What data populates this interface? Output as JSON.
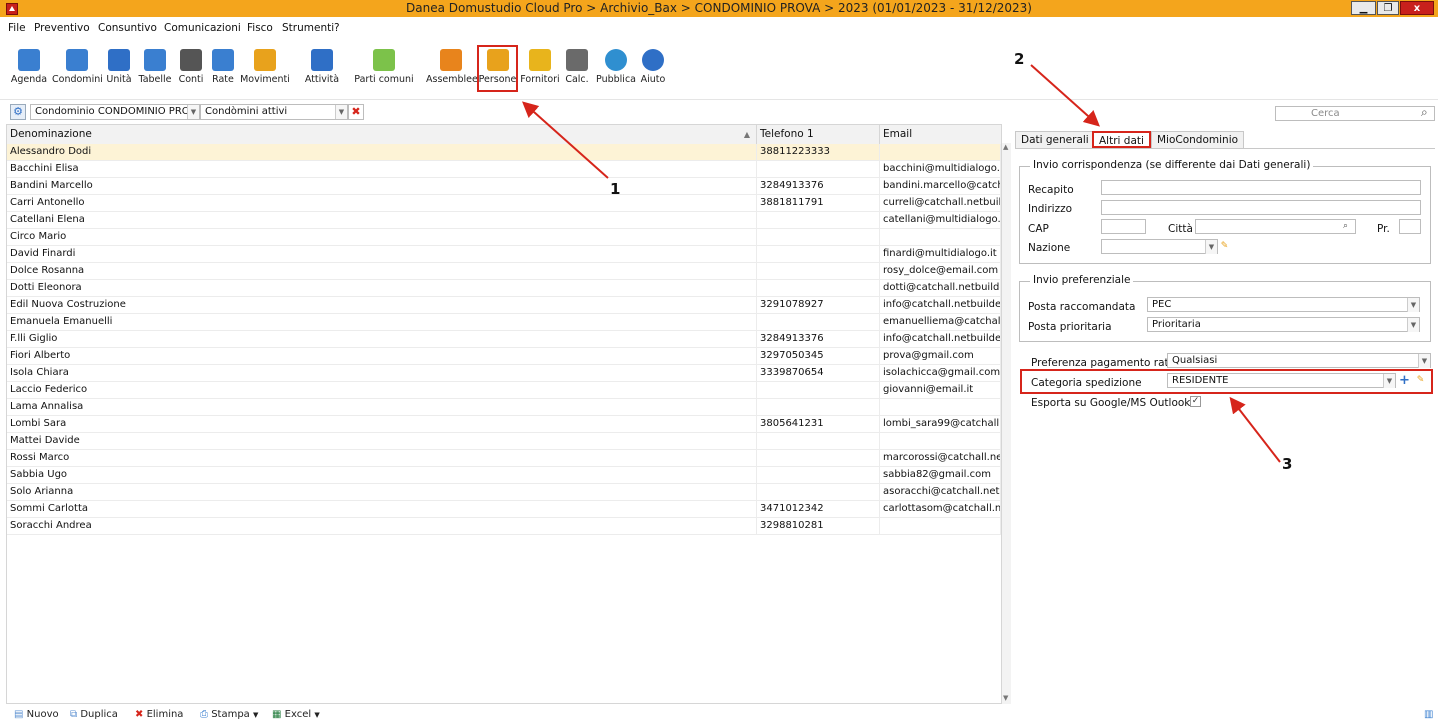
{
  "window": {
    "title": "Danea Domustudio Cloud Pro > Archivio_Bax > CONDOMINIO PROVA  > 2023    (01/01/2023 - 31/12/2023)",
    "min_glyph": "▁",
    "max_glyph": "❐",
    "close_glyph": "x"
  },
  "menu": [
    "File",
    "Preventivo",
    "Consuntivo",
    "Comunicazioni",
    "Fisco",
    "Strumenti",
    "?"
  ],
  "toolbar": [
    {
      "label": "Agenda",
      "icon": "house-icon",
      "color": "#3a7fd0"
    },
    {
      "label": "Condomini",
      "icon": "building-icon",
      "color": "#3a7fd0"
    },
    {
      "label": "Unità",
      "icon": "cubes-icon",
      "color": "#2f6fc6"
    },
    {
      "label": "Tabelle",
      "icon": "table-icon",
      "color": "#3a7fd0"
    },
    {
      "label": "Conti",
      "icon": "abacus-icon",
      "color": "#555555"
    },
    {
      "label": "Rate",
      "icon": "share-icon",
      "color": "#3a7fd0"
    },
    {
      "label": "Movimenti",
      "icon": "bar-chart-icon",
      "color": "#e8a21c"
    },
    {
      "label": "Attività",
      "icon": "drill-icon",
      "color": "#2f6fc6"
    },
    {
      "label": "Parti comuni",
      "icon": "puzzle-icon",
      "color": "#7cc24a"
    },
    {
      "label": "Assemblee",
      "icon": "people-icon",
      "color": "#e8841c"
    },
    {
      "label": "Persone",
      "icon": "persons-icon",
      "color": "#e8a21c"
    },
    {
      "label": "Fornitori",
      "icon": "supplier-icon",
      "color": "#e8b41c"
    },
    {
      "label": "Calc.",
      "icon": "calculator-icon",
      "color": "#6a6a6a"
    },
    {
      "label": "Pubblica",
      "icon": "globe-icon",
      "color": "#2f8fd0"
    },
    {
      "label": "Aiuto",
      "icon": "help-icon",
      "color": "#2f6fc6"
    }
  ],
  "filters": {
    "condominio": "Condominio CONDOMINIO PROVA",
    "stato": "Condòmini attivi",
    "search_placeholder": "Cerca"
  },
  "grid": {
    "columns": [
      "Denominazione",
      "Telefono 1",
      "Email"
    ],
    "rows": [
      [
        "Alessandro Dodi",
        "38811223333",
        ""
      ],
      [
        "Bacchini Elisa",
        "",
        "bacchini@multidialogo.it"
      ],
      [
        "Bandini Marcello",
        "3284913376",
        "bandini.marcello@catch..."
      ],
      [
        "Carri Antonello",
        "3881811791",
        "curreli@catchall.netbuild..."
      ],
      [
        "Catellani Elena",
        "",
        "catellani@multidialogo.it"
      ],
      [
        "Circo Mario",
        "",
        ""
      ],
      [
        "David Finardi",
        "",
        "finardi@multidialogo.it"
      ],
      [
        "Dolce Rosanna",
        "",
        "rosy_dolce@email.com"
      ],
      [
        "Dotti Eleonora",
        "",
        "dotti@catchall.netbuilde..."
      ],
      [
        "Edil Nuova Costruzione",
        "3291078927",
        "info@catchall.netbuilder.it"
      ],
      [
        "Emanuela Emanuelli",
        "",
        "emanuelliema@catchall...."
      ],
      [
        "F.lli Giglio",
        "3284913376",
        "info@catchall.netbuilder.it"
      ],
      [
        "Fiori Alberto",
        "3297050345",
        "prova@gmail.com"
      ],
      [
        "Isola Chiara",
        "3339870654",
        "isolachicca@gmail.com"
      ],
      [
        "Laccio Federico",
        "",
        "giovanni@email.it"
      ],
      [
        "Lama Annalisa",
        "",
        ""
      ],
      [
        "Lombi Sara",
        "3805641231",
        "lombi_sara99@catchall...."
      ],
      [
        "Mattei Davide",
        "",
        ""
      ],
      [
        "Rossi Marco",
        "",
        "marcorossi@catchall.net..."
      ],
      [
        "Sabbia Ugo",
        "",
        "sabbia82@gmail.com"
      ],
      [
        "Solo Arianna",
        "",
        "asoracchi@catchall.netb..."
      ],
      [
        "Sommi Carlotta",
        "3471012342",
        "carlottasom@catchall.ne..."
      ],
      [
        "Soracchi Andrea",
        "3298810281",
        ""
      ]
    ]
  },
  "tabs": [
    "Dati generali",
    "Altri dati",
    "MioCondominio"
  ],
  "corrispondenza": {
    "title": "Invio corrispondenza (se differente dai Dati generali)",
    "recapito_label": "Recapito",
    "indirizzo_label": "Indirizzo",
    "cap_label": "CAP",
    "citta_label": "Città",
    "pr_label": "Pr.",
    "nazione_label": "Nazione"
  },
  "preferenziale": {
    "title": "Invio preferenziale",
    "raccomandata_label": "Posta raccomandata",
    "raccomandata_value": "PEC",
    "prioritaria_label": "Posta prioritaria",
    "prioritaria_value": "Prioritaria"
  },
  "extra": {
    "pagamento_label": "Preferenza pagamento rate",
    "pagamento_value": "Qualsiasi",
    "spedizione_label": "Categoria spedizione",
    "spedizione_value": "RESIDENTE",
    "outlook_label": "Esporta su Google/MS Outlook"
  },
  "bottom": [
    "Nuovo",
    "Duplica",
    "Elimina",
    "Stampa",
    "Excel"
  ],
  "annotations": [
    "1",
    "2",
    "3"
  ],
  "colors": {
    "accent": "#d6251b",
    "titlebar": "#f4a51c",
    "selected_row": "#fdf3d6"
  }
}
